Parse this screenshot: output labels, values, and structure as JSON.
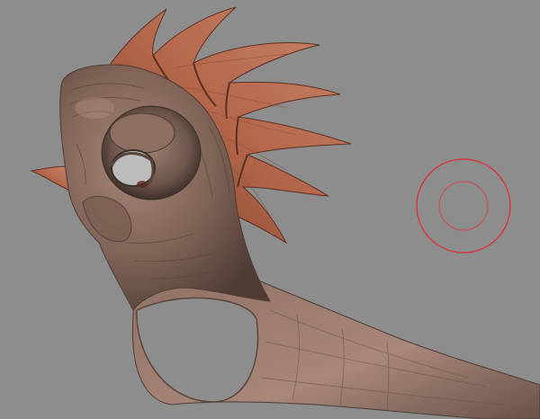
{
  "viewport": {
    "background_color": "#8d8d8d"
  },
  "model": {
    "subject": "creature-sculpt",
    "skin_color": "#8a6a5a",
    "shadow_color": "#4a3a33",
    "fin_color": "#b4664a",
    "fin_dark_color": "#7a3e2c"
  },
  "brush": {
    "icon": "brush-circle-icon",
    "outer_ring_color": "#d8343d",
    "inner_ring_color": "#c85058"
  }
}
